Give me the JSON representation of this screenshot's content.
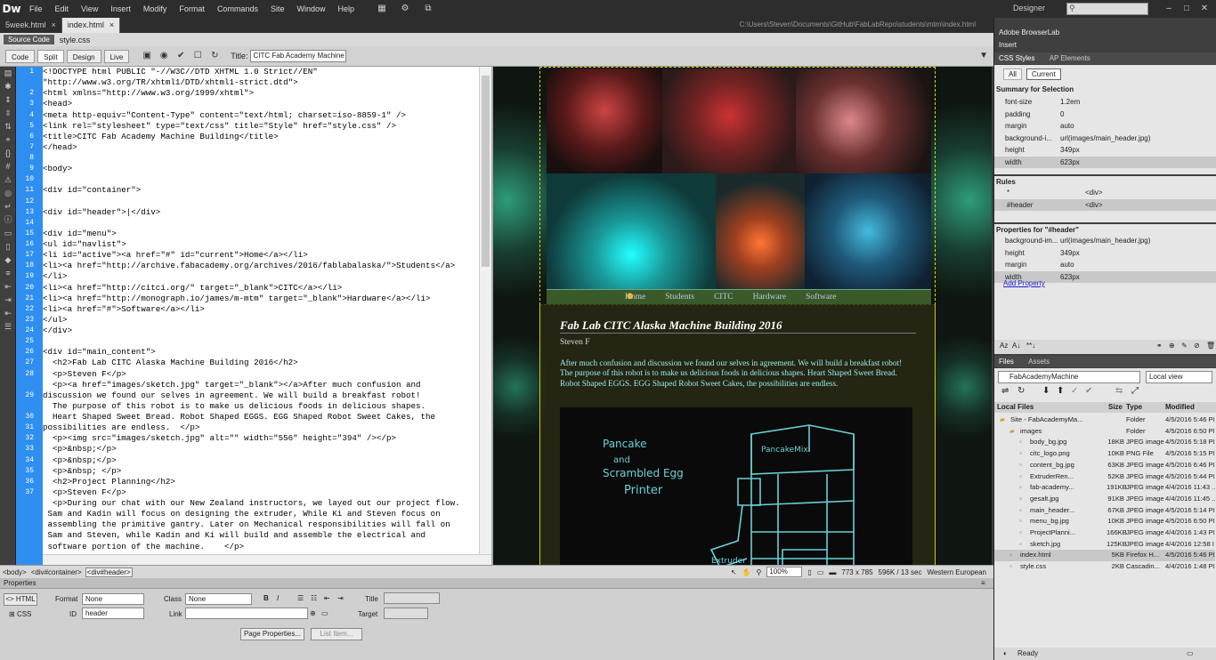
{
  "app": {
    "logo": "Dw",
    "menus": [
      "File",
      "Edit",
      "View",
      "Insert",
      "Modify",
      "Format",
      "Commands",
      "Site",
      "Window",
      "Help"
    ],
    "workspace": "Designer",
    "search_placeholder": ""
  },
  "tabs": [
    {
      "label": "5week.html",
      "active": false
    },
    {
      "label": "index.html",
      "active": true
    }
  ],
  "file_path": "C:\\Users\\Steven\\Documents\\GitHub\\FabLabRepo\\students\\mtm\\index.html",
  "related": {
    "source_code": "Source Code",
    "file": "style.css"
  },
  "view_buttons": [
    "Code",
    "Split",
    "Design",
    "Live"
  ],
  "title_label": "Title:",
  "title_value": "CITC Fab Academy Machine Bu",
  "code": {
    "line_numbers": [
      "1",
      "",
      "2",
      "3",
      "4",
      "5",
      "6",
      "7",
      "8",
      "9",
      "10",
      "11",
      "12",
      "13",
      "14",
      "15",
      "16",
      "17",
      "18",
      "19",
      "20",
      "21",
      "22",
      "23",
      "24",
      "25",
      "26",
      "27",
      "28",
      "",
      "29",
      "",
      "30",
      "31",
      "32",
      "33",
      "34",
      "35",
      "36",
      "37",
      "",
      "",
      "",
      ""
    ],
    "lines": [
      "<!DOCTYPE html PUBLIC \"-//W3C//DTD XHTML 1.0 Strict//EN\"",
      "\"http://www.w3.org/TR/xhtml1/DTD/xhtml1-strict.dtd\">",
      "<html xmlns=\"http://www.w3.org/1999/xhtml\">",
      "<head>",
      "<meta http-equiv=\"Content-Type\" content=\"text/html; charset=iso-8859-1\" />",
      "<link rel=\"stylesheet\" type=\"text/css\" title=\"Style\" href=\"style.css\" />",
      "<title>CITC Fab Academy Machine Building</title>",
      "</head>",
      "",
      "<body>",
      "",
      "<div id=\"container\">",
      "",
      "<div id=\"header\">|</div>",
      "",
      "<div id=\"menu\">",
      "<ul id=\"navlist\">",
      "<li id=\"active\"><a href=\"#\" id=\"current\">Home</a></li>",
      "<li><a href=\"http://archive.fabacademy.org/archives/2016/fablabalaska/\">Students</a>",
      "</li>",
      "<li><a href=\"http://citci.org/\" target=\"_blank\">CITC</a></li>",
      "<li><a href=\"http://monograph.io/james/m-mtm\" target=\"_blank\">Hardware</a></li>",
      "<li><a href=\"#\">Software</a></li>",
      "</ul>",
      "</div>",
      "",
      "<div id=\"main_content\">",
      "  <h2>Fab Lab CITC Alaska Machine Building 2016</h2>",
      "  <p>Steven F</p>",
      "  <p><a href=\"images/sketch.jpg\" target=\"_blank\"></a>After much confusion and",
      "discussion we found our selves in agreement. We will build a breakfast robot!",
      "  The purpose of this robot is to make us delicious foods in delicious shapes.",
      "  Heart Shaped Sweet Bread. Robot Shaped EGGS. EGG Shaped Robot Sweet Cakes, the",
      "possibilities are endless.  </p>",
      "  <p><img src=\"images/sketch.jpg\" alt=\"\" width=\"556\" height=\"394\" /></p>",
      "  <p>&nbsp;</p>",
      "  <p>&nbsp;</p>",
      "  <p>&nbsp; </p>",
      "  <h2>Project Planning</h2>",
      "  <p>Steven F</p>",
      "  <p>During our chat with our New Zealand instructors, we layed out our project flow.",
      " Sam and Kadin will focus on designing the extruder, While Ki and Steven focus on",
      " assembling the primitive gantry. Later on Mechanical responsibilities will fall on",
      " Sam and Steven, while Kadin and Ki will build and assemble the electrical and",
      " software portion of the machine.    </p>"
    ]
  },
  "design": {
    "nav": [
      "Home",
      "Students",
      "CITC",
      "Hardware",
      "Software"
    ],
    "heading": "Fab Lab CITC Alaska Machine Building 2016",
    "author": "Steven F",
    "paragraph": "After much confusion and discussion we found our selves in agreement. We will build a breakfast robot! The purpose of this robot is to make us delicious foods in delicious shapes. Heart Shaped Sweet Bread. Robot Shaped EGGS. EGG Shaped Robot Sweet Cakes, the possibilities are endless.",
    "sketch_text": [
      "Pancake",
      "and",
      "Scrambled Egg",
      "Printer",
      "PancakeMix",
      "Extruder"
    ]
  },
  "status": {
    "tags": [
      "<body>",
      "<div#container>",
      "<div#header>"
    ],
    "zoom": "100%",
    "dims": "773 x 785",
    "size": "596K / 13 sec",
    "encoding": "Western European"
  },
  "properties": {
    "title": "Properties",
    "html_btn": "HTML",
    "css_btn": "CSS",
    "format_label": "Format",
    "format_value": "None",
    "class_label": "Class",
    "class_value": "None",
    "id_label": "ID",
    "id_value": "header",
    "link_label": "Link",
    "link_value": "",
    "title_label": "Title",
    "target_label": "Target",
    "page_props": "Page Properties...",
    "list_item": "List Item...",
    "b": "B",
    "i": "I"
  },
  "right": {
    "browserlab": "Adobe BrowserLab",
    "insert": "Insert",
    "css_tabs": [
      "CSS Styles",
      "AP Elements"
    ],
    "mode_tabs": [
      "All",
      "Current"
    ],
    "summary_title": "Summary for Selection",
    "summary": [
      {
        "k": "font-size",
        "v": "1.2em"
      },
      {
        "k": "padding",
        "v": "0"
      },
      {
        "k": "margin",
        "v": "auto"
      },
      {
        "k": "background-i...",
        "v": "url(images/main_header.jpg)"
      },
      {
        "k": "height",
        "v": "349px"
      },
      {
        "k": "width",
        "v": "623px"
      }
    ],
    "rules_title": "Rules",
    "rules": [
      {
        "k": "*",
        "v": "<div>"
      },
      {
        "k": "#header",
        "v": "<div>"
      }
    ],
    "props_title": "Properties for \"#header\"",
    "props": [
      {
        "k": "background-im...",
        "v": "url(images/main_header.jpg)"
      },
      {
        "k": "height",
        "v": "349px"
      },
      {
        "k": "margin",
        "v": "auto"
      },
      {
        "k": "width",
        "v": "623px"
      }
    ],
    "add_property": "Add Property",
    "files_tabs": [
      "Files",
      "Assets"
    ],
    "site": "FabAcademyMachine",
    "view": "Local view",
    "files_cols": [
      "Local Files",
      "Size",
      "Type",
      "Modified"
    ],
    "files": [
      {
        "name": "Site - FabAcademyMa...",
        "size": "",
        "type": "Folder",
        "mod": "4/5/2016 5:46 PI",
        "lvl": 0
      },
      {
        "name": "images",
        "size": "",
        "type": "Folder",
        "mod": "4/5/2016 6:50 PI",
        "lvl": 1
      },
      {
        "name": "body_bg.jpg",
        "size": "18KB",
        "type": "JPEG image",
        "mod": "4/5/2016 5:18 PI",
        "lvl": 2
      },
      {
        "name": "citc_logo.png",
        "size": "10KB",
        "type": "PNG File",
        "mod": "4/5/2016 5:15 PI",
        "lvl": 2
      },
      {
        "name": "content_bg.jpg",
        "size": "63KB",
        "type": "JPEG image",
        "mod": "4/5/2016 6:46 PI",
        "lvl": 2
      },
      {
        "name": "ExtruderRen...",
        "size": "52KB",
        "type": "JPEG image",
        "mod": "4/5/2016 5:44 PI",
        "lvl": 2
      },
      {
        "name": "fab-academy...",
        "size": "191KB",
        "type": "JPEG image",
        "mod": "4/4/2016 11:43 ..",
        "lvl": 2
      },
      {
        "name": "gesalt.jpg",
        "size": "91KB",
        "type": "JPEG image",
        "mod": "4/4/2016 11:45 ..",
        "lvl": 2
      },
      {
        "name": "main_header...",
        "size": "67KB",
        "type": "JPEG image",
        "mod": "4/5/2016 5:14 PI",
        "lvl": 2
      },
      {
        "name": "menu_bg.jpg",
        "size": "10KB",
        "type": "JPEG image",
        "mod": "4/5/2016 6:50 PI",
        "lvl": 2
      },
      {
        "name": "ProjectPlanni...",
        "size": "166KB",
        "type": "JPEG image",
        "mod": "4/4/2016 1:43 PI",
        "lvl": 2
      },
      {
        "name": "sketch.jpg",
        "size": "125KB",
        "type": "JPEG image",
        "mod": "4/4/2016 12:58 I",
        "lvl": 2
      },
      {
        "name": "index.html",
        "size": "5KB",
        "type": "Firefox H...",
        "mod": "4/5/2016 5:46 PI",
        "lvl": 1
      },
      {
        "name": "style.css",
        "size": "2KB",
        "type": "Cascadin...",
        "mod": "4/4/2016 1:48 PI",
        "lvl": 1
      }
    ],
    "ready": "Ready"
  }
}
